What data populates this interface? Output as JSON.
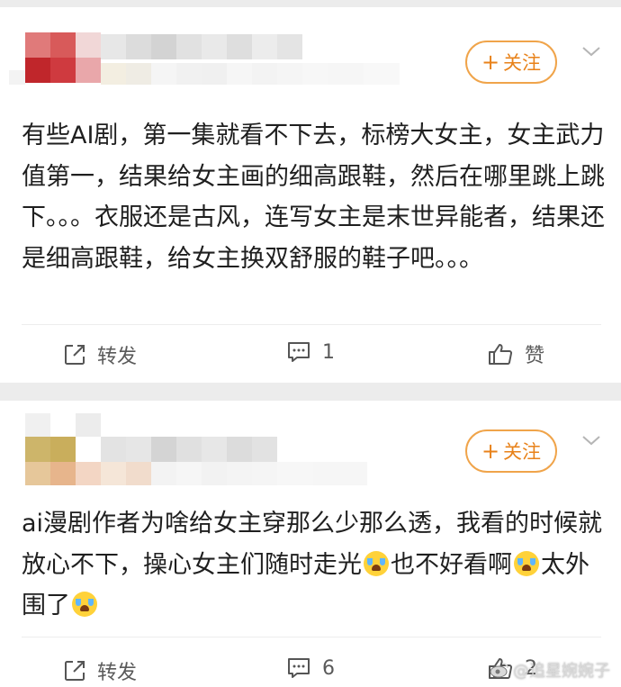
{
  "posts": [
    {
      "follow_label": "关注",
      "follow_plus": "+",
      "text": "有些AI剧，第一集就看不下去，标榜大女主，女主武力值第一，结果给女主画的细高跟鞋，然后在哪里跳上跳下。。。衣服还是古风，连写女主是末世异能者，结果还是细高跟鞋，给女主换双舒服的鞋子吧。。。",
      "actions": {
        "repost_label": "转发",
        "comment_count": "1",
        "like_label": "赞"
      }
    },
    {
      "follow_label": "关注",
      "follow_plus": "+",
      "text_parts": [
        "ai漫剧作者为啥给女主穿那么少那么透，我看的时候就放心不下，操心女主们随时走光",
        "也不好看啊",
        "太外围了"
      ],
      "actions": {
        "repost_label": "转发",
        "comment_count": "6",
        "like_count": "2"
      }
    }
  ],
  "watermark": {
    "text": "@追星婉婉子"
  },
  "icons": [
    "repost-icon",
    "comment-icon",
    "like-icon",
    "chevron-down-icon",
    "crying-emoji-icon",
    "weibo-logo-icon"
  ],
  "colors": {
    "follow_accent": "#e8821a",
    "follow_border": "#f0a44a",
    "separator": "#ececec"
  }
}
